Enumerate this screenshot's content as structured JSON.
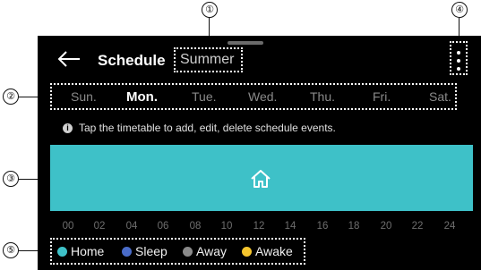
{
  "callouts": [
    "①",
    "②",
    "③",
    "④",
    "⑤"
  ],
  "header": {
    "title": "Schedule",
    "subtitle": "Summer"
  },
  "days": [
    "Sun.",
    "Mon.",
    "Tue.",
    "Wed.",
    "Thu.",
    "Fri.",
    "Sat."
  ],
  "selected_day": "Mon.",
  "info": {
    "text": "Tap the timetable to add, edit, delete schedule events."
  },
  "timetable": {
    "color": "#3ec1c8",
    "event": "home-icon"
  },
  "hours": [
    "00",
    "02",
    "04",
    "06",
    "08",
    "10",
    "12",
    "14",
    "16",
    "18",
    "20",
    "22",
    "24"
  ],
  "legend": [
    {
      "label": "Home",
      "color": "#3ec1c8"
    },
    {
      "label": "Sleep",
      "color": "#4a6cc9"
    },
    {
      "label": "Away",
      "color": "#8a8a8a"
    },
    {
      "label": "Awake",
      "color": "#f5c52d"
    }
  ]
}
